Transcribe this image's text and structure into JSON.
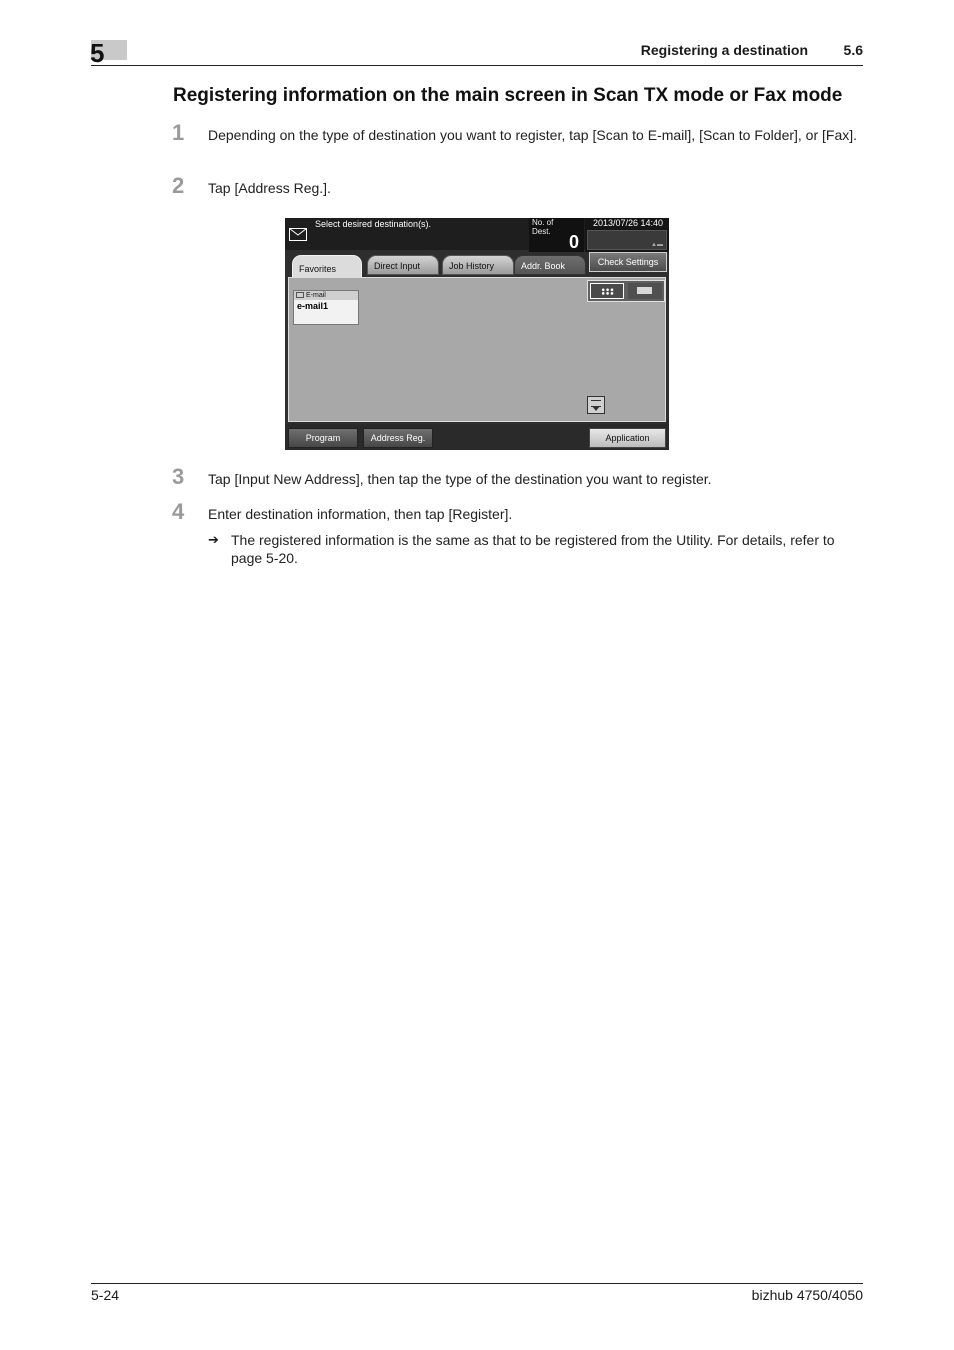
{
  "header": {
    "chapter": "5",
    "title": "Registering a destination",
    "section": "5.6"
  },
  "heading": "Registering information on the main screen in Scan TX mode or Fax mode",
  "steps": [
    {
      "num": "1",
      "text": "Depending on the type of destination you want to register, tap [Scan to E-mail], [Scan to Folder], or [Fax]."
    },
    {
      "num": "2",
      "text": "Tap [Address Reg.]."
    },
    {
      "num": "3",
      "text": "Tap [Input New Address], then tap the type of the destination you want to register."
    },
    {
      "num": "4",
      "text": "Enter destination information, then tap [Register]."
    }
  ],
  "note": {
    "arrow": "➔",
    "text": "The registered information is the same as that to be registered from the Utility. For details, refer to page 5-20."
  },
  "screen": {
    "message": "Select desired destination(s).",
    "num_dest_label": "No. of Dest.",
    "num_dest_value": "0",
    "datetime": "2013/07/26 14:40",
    "tabs": {
      "favorites": "Favorites",
      "direct_input": "Direct Input",
      "job_history": "Job History",
      "addr_book": "Addr. Book"
    },
    "check_settings": "Check Settings",
    "card": {
      "type": "E-mail",
      "name": "e-mail1"
    },
    "buttons": {
      "program": "Program",
      "address_reg": "Address Reg.",
      "application": "Application"
    },
    "icons": {
      "mail": "envelope-icon",
      "grid_view": "grid-view-icon",
      "list_view": "list-view-icon",
      "scroll": "scroll-down-icon"
    }
  },
  "footer": {
    "page": "5-24",
    "product": "bizhub 4750/4050"
  }
}
